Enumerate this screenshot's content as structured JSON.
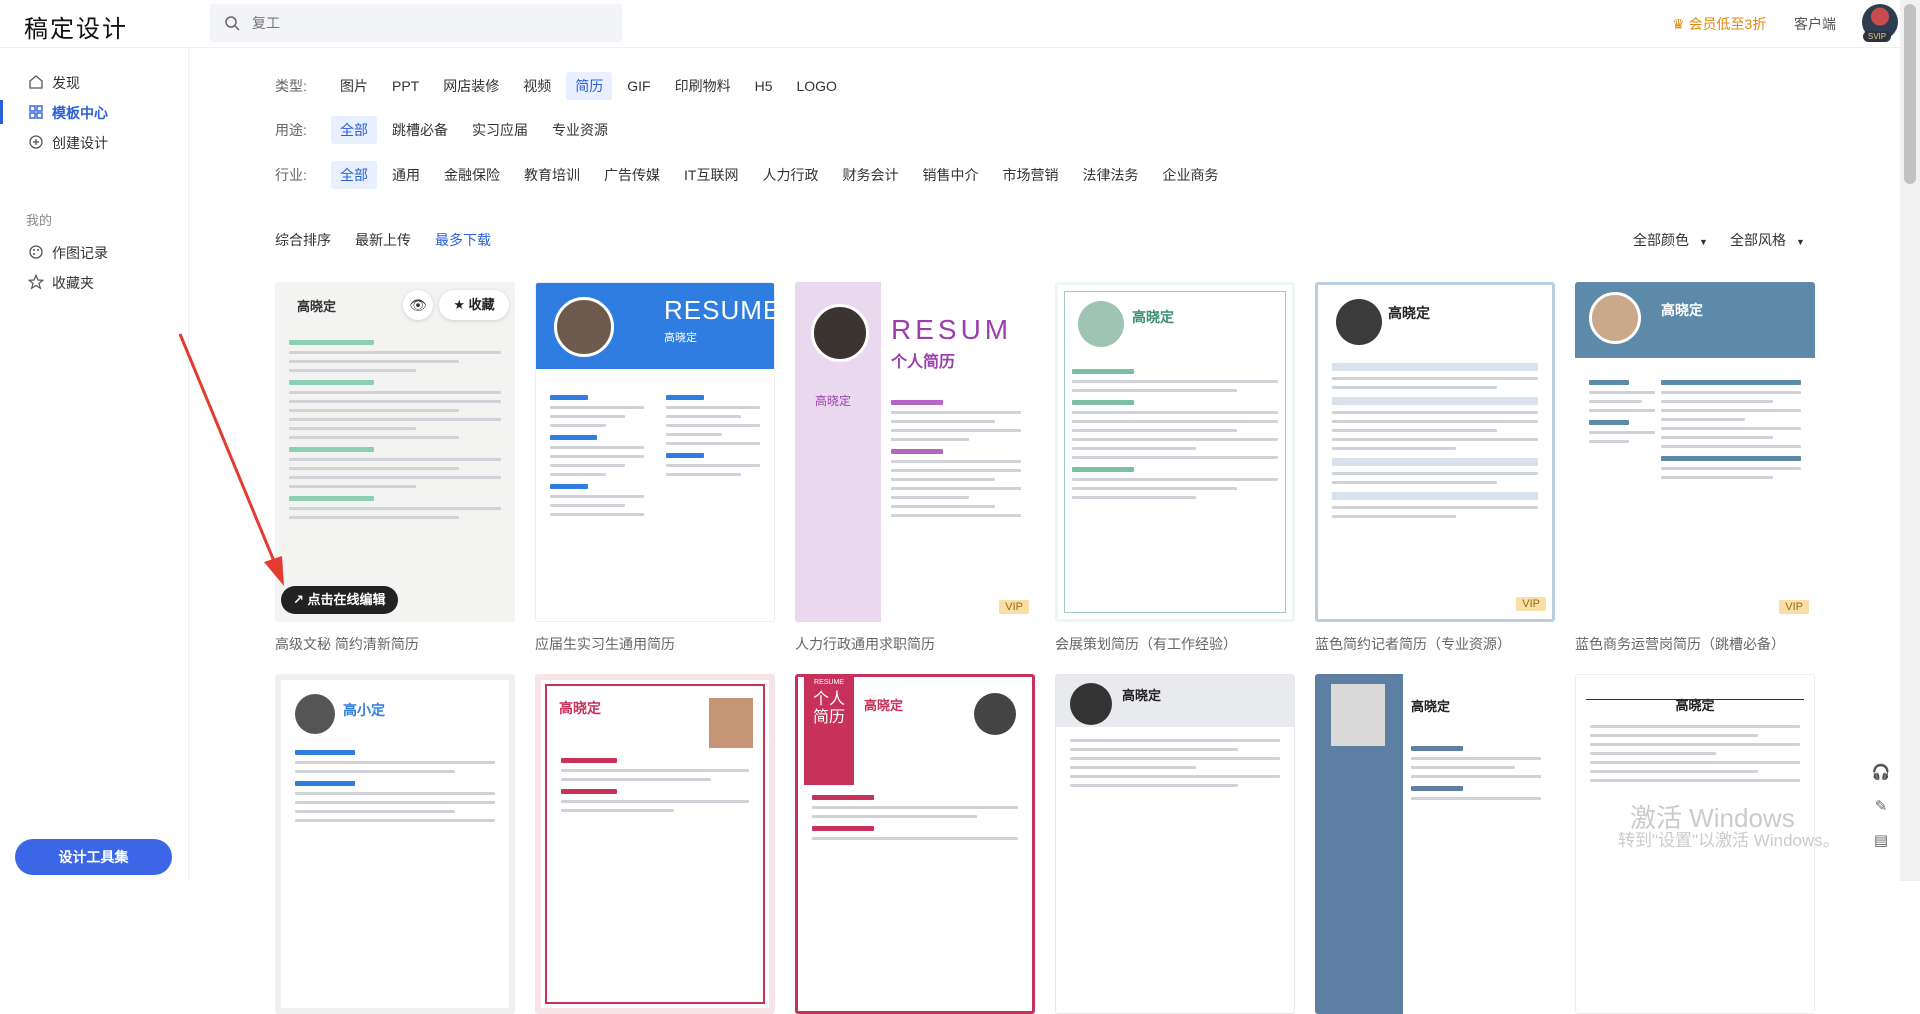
{
  "header": {
    "logo": "稿定设计",
    "search_placeholder": "复工",
    "vip_promo": "会员低至3折",
    "client_link": "客户端",
    "avatar_badge": "SVIP"
  },
  "sidebar": {
    "items": [
      {
        "label": "发现",
        "icon": "home-icon"
      },
      {
        "label": "模板中心",
        "icon": "grid-icon"
      },
      {
        "label": "创建设计",
        "icon": "plus-circle-icon"
      }
    ],
    "section_label": "我的",
    "my_items": [
      {
        "label": "作图记录",
        "icon": "palette-icon"
      },
      {
        "label": "收藏夹",
        "icon": "star-icon"
      }
    ],
    "tool_button": "设计工具集"
  },
  "filters": {
    "type": {
      "label": "类型:",
      "options": [
        "图片",
        "PPT",
        "网店装修",
        "视频",
        "简历",
        "GIF",
        "印刷物料",
        "H5",
        "LOGO"
      ],
      "selected": "简历"
    },
    "usage": {
      "label": "用途:",
      "options": [
        "全部",
        "跳槽必备",
        "实习应届",
        "专业资源"
      ],
      "selected": "全部"
    },
    "industry": {
      "label": "行业:",
      "options": [
        "全部",
        "通用",
        "金融保险",
        "教育培训",
        "广告传媒",
        "IT互联网",
        "人力行政",
        "财务会计",
        "销售中介",
        "市场营销",
        "法律法务",
        "企业商务"
      ],
      "selected": "全部"
    }
  },
  "sort": {
    "options": [
      "综合排序",
      "最新上传",
      "最多下载"
    ],
    "selected": "最多下载",
    "color_filter": "全部颜色",
    "style_filter": "全部风格"
  },
  "cards": [
    {
      "title": "高级文秘 简约清新简历",
      "vip": false
    },
    {
      "title": "应届生实习生通用简历",
      "vip": false
    },
    {
      "title": "人力行政通用求职简历",
      "vip": true
    },
    {
      "title": "会展策划简历（有工作经验）",
      "vip": false
    },
    {
      "title": "蓝色简约记者简历（专业资源）",
      "vip": true
    },
    {
      "title": "蓝色商务运营岗简历（跳槽必备）",
      "vip": true
    }
  ],
  "thumb_text": {
    "name": "高晓定",
    "name2": "高小定",
    "resume_en": "RESUME",
    "resum_en": "RESUM",
    "resume_cn": "个人简历",
    "resume_cn_vertical": "个人简历",
    "resume_small": "RESUME"
  },
  "hover": {
    "favorite": "收藏",
    "edit": "点击在线编辑"
  },
  "vip_tag": "VIP",
  "watermark": {
    "line1": "激活 Windows",
    "line2": "转到\"设置\"以激活 Windows。"
  }
}
